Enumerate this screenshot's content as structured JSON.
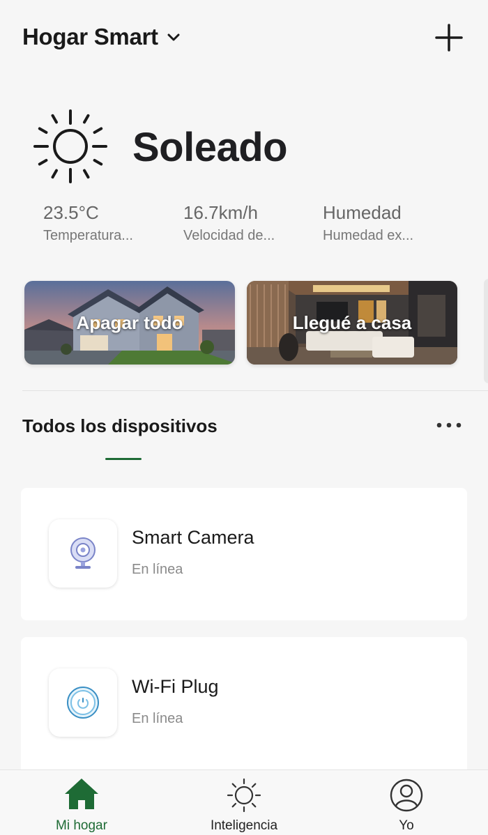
{
  "header": {
    "home_name": "Hogar Smart",
    "dropdown_icon": "chevron-down-icon",
    "add_icon": "plus-icon"
  },
  "weather": {
    "icon": "sun-icon",
    "condition": "Soleado",
    "stats": [
      {
        "value": "23.5°C",
        "label": "Temperatura..."
      },
      {
        "value": "16.7km/h",
        "label": "Velocidad de..."
      },
      {
        "value": "Humedad",
        "label": "Humedad ex..."
      }
    ]
  },
  "scenes": [
    {
      "label": "Apagar todo"
    },
    {
      "label": "Llegué a casa"
    }
  ],
  "devices_section": {
    "title": "Todos los dispositivos",
    "more_icon": "more-horizontal-icon"
  },
  "devices": [
    {
      "name": "Smart Camera",
      "status": "En línea",
      "icon": "camera-icon"
    },
    {
      "name": "Wi-Fi Plug",
      "status": "En línea",
      "icon": "plug-icon"
    }
  ],
  "bottom_nav": {
    "items": [
      {
        "label": "Mi hogar",
        "icon": "home-icon",
        "active": true
      },
      {
        "label": "Inteligencia",
        "icon": "sun-icon",
        "active": false
      },
      {
        "label": "Yo",
        "icon": "user-icon",
        "active": false
      }
    ]
  },
  "colors": {
    "accent": "#1e6b35",
    "background": "#f6f6f6",
    "card": "#ffffff"
  }
}
